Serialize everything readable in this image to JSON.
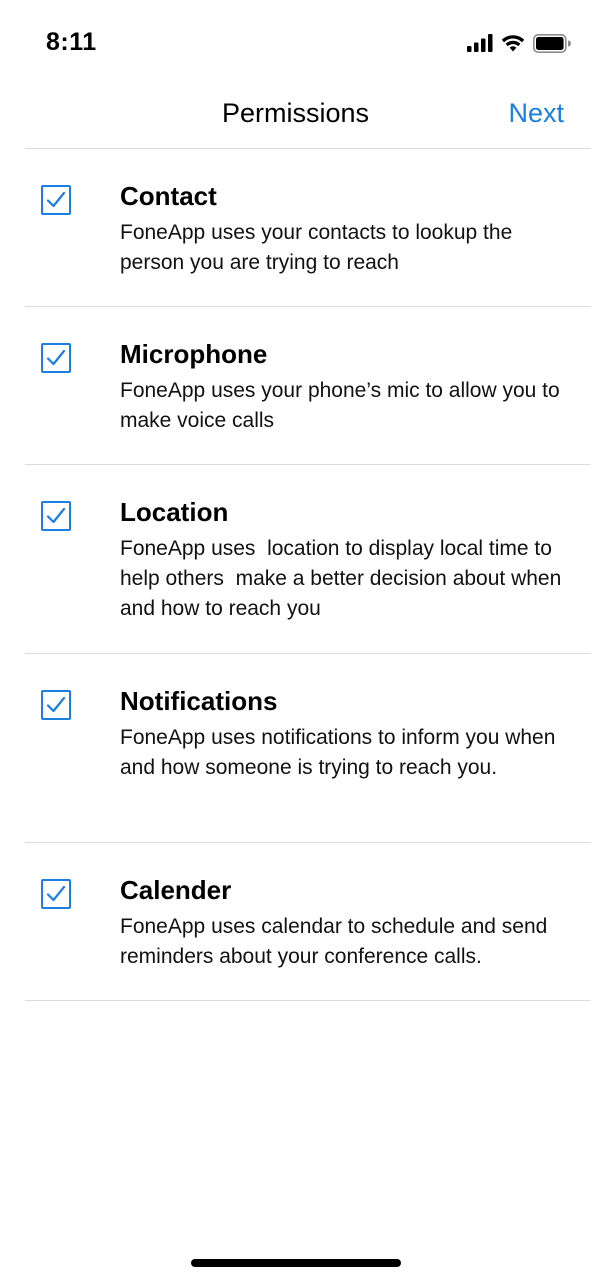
{
  "status_bar": {
    "time": "8:11",
    "icons": [
      "signal-icon",
      "wifi-icon",
      "battery-icon"
    ]
  },
  "nav": {
    "title": "Permissions",
    "next_label": "Next"
  },
  "colors": {
    "accent": "#1a7fe0",
    "divider": "#dcdcdc"
  },
  "permissions": [
    {
      "title": "Contact",
      "description": "FoneApp uses your contacts to lookup the person you are trying to reach",
      "checked": true
    },
    {
      "title": "Microphone",
      "description": "FoneApp uses your phone’s mic to allow you to make voice calls",
      "checked": true
    },
    {
      "title": "Location",
      "description": "FoneApp uses  location to display local time to help others  make a better decision about when and how to reach you",
      "checked": true
    },
    {
      "title": "Notifications",
      "description": "FoneApp uses notifications to inform you when and how someone is trying to reach you.",
      "checked": true
    },
    {
      "title": "Calender",
      "description": "FoneApp uses calendar to schedule and send reminders about your conference calls.",
      "checked": true
    }
  ]
}
